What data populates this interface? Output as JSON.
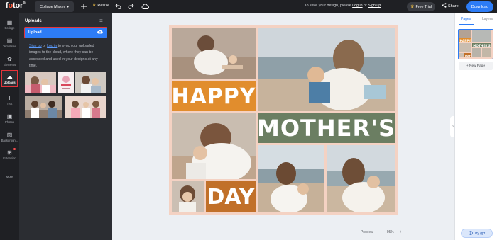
{
  "topbar": {
    "logo": "fotor",
    "mode_label": "Collage Maker",
    "resize_label": "Resize",
    "save_message": "To save your design, please",
    "login_link": "Log in",
    "or_text": "or",
    "signup_link": "Sign up",
    "period": ".",
    "free_trial_label": "Free Trial",
    "share_label": "Share",
    "download_label": "Download"
  },
  "rail": [
    {
      "label": "Collage",
      "icon": "collage-icon",
      "glyph": "▦"
    },
    {
      "label": "Templates",
      "icon": "templates-icon",
      "glyph": "▤"
    },
    {
      "label": "Elements",
      "icon": "elements-icon",
      "glyph": "✿"
    },
    {
      "label": "Uploads",
      "icon": "upload-cloud-icon",
      "glyph": "☁",
      "active": true
    },
    {
      "label": "Text",
      "icon": "text-icon",
      "glyph": "T"
    },
    {
      "label": "Photos",
      "icon": "photos-icon",
      "glyph": "▣"
    },
    {
      "label": "Backgroun...",
      "icon": "background-icon",
      "glyph": "▨"
    },
    {
      "label": "Extension",
      "icon": "extension-icon",
      "glyph": "⊞",
      "badge": true
    },
    {
      "label": "More",
      "icon": "more-icon",
      "glyph": "⋯"
    }
  ],
  "panel": {
    "title": "Uploads",
    "upload_label": "Upload",
    "signup_link": "Sign up",
    "or_text": "or",
    "login_link": "Log in",
    "description": "to sync your uploaded images to the cloud, where they can be accessed and used in your designs at any time."
  },
  "collage": {
    "word_happy": "HAPPY",
    "word_mothers": "MOTHER'S",
    "word_day": "DAY"
  },
  "zoom": {
    "preview_label": "Preview",
    "minus": "−",
    "value": "95%",
    "plus": "+"
  },
  "right_panel": {
    "tab_pages": "Pages",
    "tab_layers": "Layers",
    "new_page_label": "+ New Page",
    "try_gpt_label": "Try gpt"
  },
  "colors": {
    "accent_blue": "#2d7cf6",
    "active_outline": "#e5333a",
    "happy_block": "#e18d2d",
    "mothers_block": "#6b7e62",
    "day_block": "#c17029",
    "collage_border": "#f4d2c3"
  }
}
